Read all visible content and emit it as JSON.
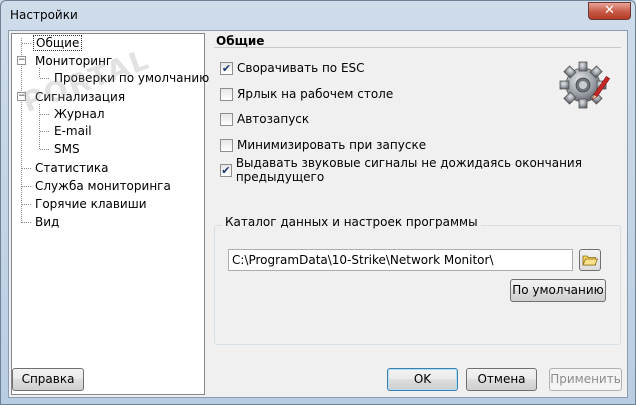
{
  "window": {
    "title": "Настройки",
    "close_label": "✕"
  },
  "tree": {
    "items": [
      {
        "label": "Общие"
      },
      {
        "label": "Мониторинг"
      },
      {
        "label": "Проверки по умолчанию"
      },
      {
        "label": "Сигнализация"
      },
      {
        "label": "Журнал"
      },
      {
        "label": "E-mail"
      },
      {
        "label": "SMS"
      },
      {
        "label": "Статистика"
      },
      {
        "label": "Служба мониторинга"
      },
      {
        "label": "Горячие клавиши"
      },
      {
        "label": "Вид"
      }
    ],
    "expander_open": "−"
  },
  "panel": {
    "title": "Общие",
    "checkboxes": [
      {
        "label": "Сворачивать по ESC",
        "checked": true
      },
      {
        "label": "Ярлык на рабочем столе",
        "checked": false
      },
      {
        "label": "Автозапуск",
        "checked": false
      },
      {
        "label": "Минимизировать при запуске",
        "checked": false
      },
      {
        "label": "Выдавать звуковые сигналы не дожидаясь окончания предыдущего",
        "checked": true
      }
    ],
    "check_mark": "✔",
    "data_group": {
      "legend": "Каталог данных и настроек программы",
      "path_value": "C:\\ProgramData\\10-Strike\\Network Monitor\\",
      "default_button": "По умолчанию"
    }
  },
  "buttons": {
    "help": "Справка",
    "ok": "OK",
    "cancel": "Отмена",
    "apply": "Применить"
  },
  "watermark": "PORTAL",
  "colors": {
    "selection_border": "#333333",
    "accent": "#3c7fb1"
  }
}
